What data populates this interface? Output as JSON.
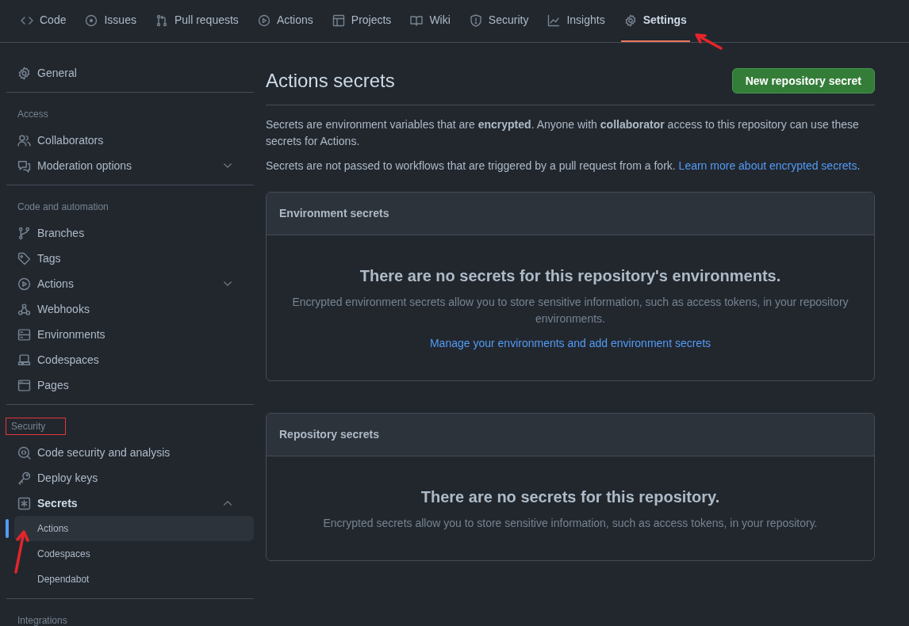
{
  "tabs": [
    {
      "label": "Code",
      "kind": "code",
      "selected": false,
      "annotated": false
    },
    {
      "label": "Issues",
      "kind": "issue",
      "selected": false,
      "annotated": false
    },
    {
      "label": "Pull requests",
      "kind": "pull",
      "selected": false,
      "annotated": false
    },
    {
      "label": "Actions",
      "kind": "play",
      "selected": false,
      "annotated": false
    },
    {
      "label": "Projects",
      "kind": "table",
      "selected": false,
      "annotated": false
    },
    {
      "label": "Wiki",
      "kind": "book",
      "selected": false,
      "annotated": false
    },
    {
      "label": "Security",
      "kind": "shield",
      "selected": false,
      "annotated": false
    },
    {
      "label": "Insights",
      "kind": "graph",
      "selected": false,
      "annotated": false
    },
    {
      "label": "Settings",
      "kind": "gear",
      "selected": true,
      "annotated": true
    }
  ],
  "sidebar": {
    "sections": [
      {
        "items": [
          {
            "label": "General",
            "kind": "gear"
          }
        ]
      },
      {
        "heading": "Access",
        "annotated": false,
        "items": [
          {
            "label": "Collaborators",
            "kind": "people"
          },
          {
            "label": "Moderation options",
            "kind": "comment",
            "expanded": false
          }
        ]
      },
      {
        "heading": "Code and automation",
        "annotated": false,
        "items": [
          {
            "label": "Branches",
            "kind": "branch"
          },
          {
            "label": "Tags",
            "kind": "tag"
          },
          {
            "label": "Actions",
            "kind": "play",
            "expanded": false
          },
          {
            "label": "Webhooks",
            "kind": "webhook"
          },
          {
            "label": "Environments",
            "kind": "server"
          },
          {
            "label": "Codespaces",
            "kind": "laptop"
          },
          {
            "label": "Pages",
            "kind": "browser"
          }
        ]
      },
      {
        "heading": "Security",
        "annotated": true,
        "items": [
          {
            "label": "Code security and analysis",
            "kind": "codescan"
          },
          {
            "label": "Deploy keys",
            "kind": "key"
          },
          {
            "label": "Secrets",
            "kind": "asterisk",
            "expanded": true,
            "children": [
              {
                "label": "Actions",
                "selected": true,
                "annotated": true
              },
              {
                "label": "Codespaces",
                "selected": false,
                "annotated": false
              },
              {
                "label": "Dependabot",
                "selected": false,
                "annotated": false
              }
            ]
          }
        ]
      },
      {
        "heading": "Integrations",
        "annotated": false
      }
    ]
  },
  "main": {
    "title": "Actions secrets",
    "button": "New repository secret",
    "intro": "Secrets are environment variables that are **encrypted**. Anyone with **collaborator** access to this repository can use these secrets for Actions.",
    "note": "Secrets are not passed to workflows that are triggered by a pull request from a fork.",
    "note_link": "Learn more about encrypted secrets",
    "note_end": ".",
    "boxes": [
      {
        "title": "Environment secrets",
        "empty_title": "There are no secrets for this repository's environments.",
        "empty_text": "Encrypted environment secrets allow you to store sensitive information, such as access tokens, in your repository environments.",
        "link": "Manage your environments and add environment secrets"
      },
      {
        "title": "Repository secrets",
        "empty_title": "There are no secrets for this repository.",
        "empty_text": "Encrypted secrets allow you to store sensitive information, such as access tokens, in your repository."
      }
    ]
  }
}
